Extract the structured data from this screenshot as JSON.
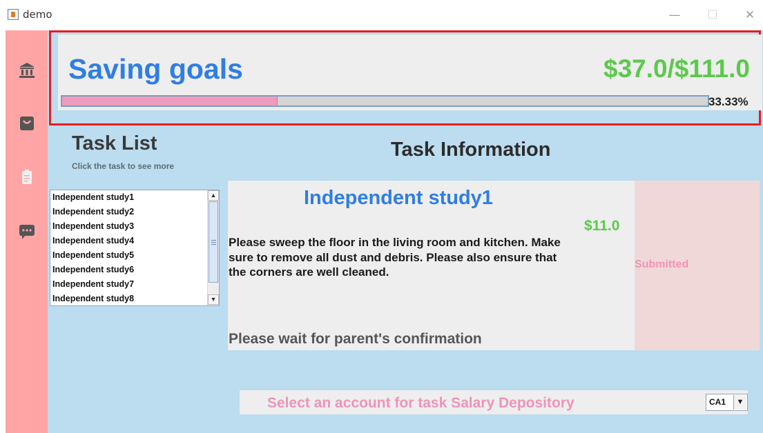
{
  "window": {
    "title": "demo",
    "controls": {
      "minimize": "—",
      "maximize": "☐",
      "close": "✕"
    },
    "icons": {
      "app": "java-app-icon"
    }
  },
  "sidebar": {
    "items": [
      {
        "name": "bank",
        "icon": "bank-icon"
      },
      {
        "name": "shop",
        "icon": "shopping-bag-icon"
      },
      {
        "name": "tasks",
        "icon": "clipboard-icon"
      },
      {
        "name": "messages",
        "icon": "chat-icon"
      }
    ],
    "colors": {
      "background": "#ffa5a5",
      "icon": "#555555"
    }
  },
  "saving_goals": {
    "title": "Saving goals",
    "amount": "$37.0/$111.0",
    "progress_fraction": 0.3333,
    "progress_label": "33.33%",
    "colors": {
      "title": "#2f7ee3",
      "amount": "#5cc94c",
      "fill": "#f09bbd",
      "highlight_border": "#ea1c1c"
    }
  },
  "task_list": {
    "title": "Task List",
    "hint": "Click the task to see more",
    "items": [
      "Independent study1",
      "Independent study2",
      "Independent study3",
      "Independent study4",
      "Independent study5",
      "Independent study6",
      "Independent study7",
      "Independent study8"
    ]
  },
  "task_info": {
    "title": "Task Information",
    "name": "Independent study1",
    "reward": "$11.0",
    "description": "Please sweep the floor in the living room and kitchen. Make sure to remove all dust and debris. Please also ensure that the corners are well cleaned.",
    "wait_message": "Please wait for parent's confirmation",
    "status": "Submitted"
  },
  "deposit": {
    "label": "Select an account for task Salary Depository",
    "selected_account": "CA1",
    "arrow": "▼"
  },
  "colors": {
    "main_background": "#bcdcef",
    "panel": "#eeeeee",
    "status_panel": "#f1d8d8",
    "pink_text": "#ef93b9"
  }
}
